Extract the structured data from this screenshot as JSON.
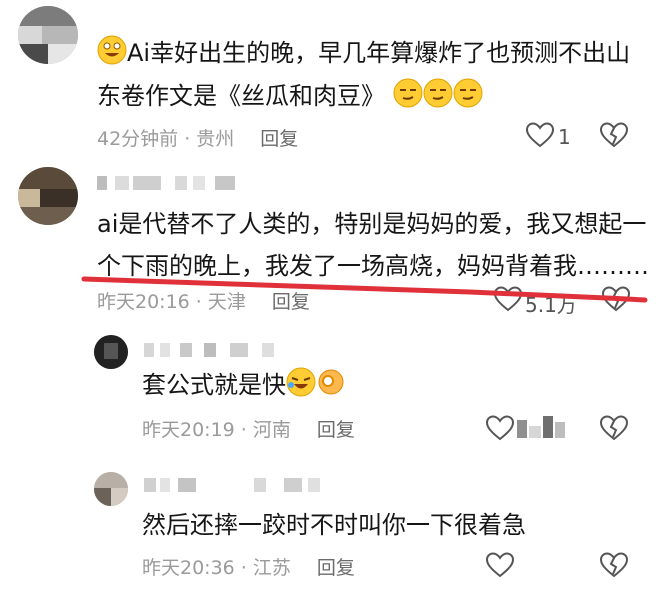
{
  "comments": [
    {
      "text_line1": "Ai幸好出生的晚，早几年算爆炸了也预测不出山",
      "text_line2": "东卷作文是《丝瓜和肉豆》",
      "time_location": "42分钟前 · 贵州",
      "reply_label": "回复",
      "like_count": "1",
      "emoji_prefix": "grinning-face-emoji",
      "emoji_suffix": "smirk-face-emoji"
    },
    {
      "text_line1": "ai是代替不了人类的，特别是妈妈的爱，我又想起一",
      "text_line2": "个下雨的晚上，我发了一场高烧，妈妈背着我………",
      "time_location": "昨天20:16 · 天津",
      "reply_label": "回复",
      "like_count": "5.1万"
    },
    {
      "text": "套公式就是快",
      "time_location": "昨天20:19 · 河南",
      "reply_label": "回复",
      "emoji": "laughing-tears-and-ok-hand-emoji"
    },
    {
      "text": "然后还摔一跤时不时叫你一下很着急",
      "time_location": "昨天20:36 · 江苏",
      "reply_label": "回复"
    }
  ],
  "colors": {
    "annotation_line": "#e0313b",
    "meta_text": "#9a9a9a",
    "body_text": "#161616"
  }
}
